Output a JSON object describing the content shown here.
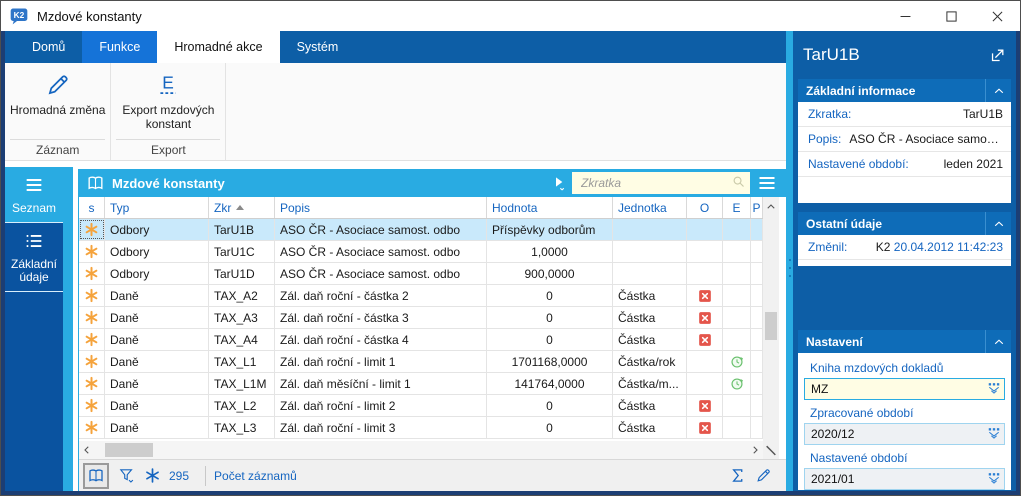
{
  "window": {
    "title": "Mzdové konstanty",
    "controls": [
      {
        "name": "minimize",
        "icon": "minimize-icon"
      },
      {
        "name": "maximize",
        "icon": "maximize-icon"
      },
      {
        "name": "close",
        "icon": "close-icon"
      }
    ]
  },
  "ribbon": {
    "tabs": [
      {
        "label": "Domů",
        "state": "normal"
      },
      {
        "label": "Funkce",
        "state": "highlight"
      },
      {
        "label": "Hromadné akce",
        "state": "active"
      },
      {
        "label": "Systém",
        "state": "normal"
      }
    ],
    "groups": [
      {
        "label": "Záznam",
        "buttons": [
          {
            "label": "Hromadná změna",
            "icon": "pencil-icon"
          }
        ]
      },
      {
        "label": "Export",
        "buttons": [
          {
            "label": "Export mzdových konstant",
            "icon": "export-e-icon"
          }
        ]
      }
    ]
  },
  "sidebar": {
    "items": [
      {
        "label": "Seznam",
        "icon": "menu-icon",
        "active": true
      },
      {
        "label": "Základní údaje",
        "icon": "list-icon",
        "active": false
      }
    ]
  },
  "browse": {
    "title": "Mzdové konstanty",
    "title_icon": "book-icon",
    "quick_filter_icon": "play-icon",
    "menu_icon": "hamburger-icon",
    "search_placeholder": "Zkratka",
    "search_icon": "search-icon",
    "columns": [
      {
        "key": "s",
        "label": "s"
      },
      {
        "key": "typ",
        "label": "Typ"
      },
      {
        "key": "zkr",
        "label": "Zkr",
        "sorted": "asc"
      },
      {
        "key": "popis",
        "label": "Popis"
      },
      {
        "key": "hodnota",
        "label": "Hodnota"
      },
      {
        "key": "jednotka",
        "label": "Jednotka"
      },
      {
        "key": "o",
        "label": "O"
      },
      {
        "key": "e",
        "label": "E"
      },
      {
        "key": "p",
        "label": "P"
      }
    ],
    "rows": [
      {
        "s": "asterisk-icon",
        "typ": "Odbory",
        "zkr": "TarU1B",
        "popis": "ASO ČR - Asociace samost. odbo",
        "hodnota": "Příspěvky odborům",
        "jednotka": "",
        "o": "",
        "e": "",
        "selected": true
      },
      {
        "s": "asterisk-icon",
        "typ": "Odbory",
        "zkr": "TarU1C",
        "popis": "ASO ČR - Asociace samost. odbo",
        "hodnota": "1,0000",
        "jednotka": "",
        "o": "",
        "e": ""
      },
      {
        "s": "asterisk-icon",
        "typ": "Odbory",
        "zkr": "TarU1D",
        "popis": "ASO ČR - Asociace samost. odbo",
        "hodnota": "900,0000",
        "jednotka": "",
        "o": "",
        "e": ""
      },
      {
        "s": "asterisk-icon",
        "typ": "Daně",
        "zkr": "TAX_A2",
        "popis": "Zál. daň roční - částka 2",
        "hodnota": "0",
        "jednotka": "Částka",
        "o": "red-x-icon",
        "e": ""
      },
      {
        "s": "asterisk-icon",
        "typ": "Daně",
        "zkr": "TAX_A3",
        "popis": "Zál. daň roční - částka 3",
        "hodnota": "0",
        "jednotka": "Částka",
        "o": "red-x-icon",
        "e": ""
      },
      {
        "s": "asterisk-icon",
        "typ": "Daně",
        "zkr": "TAX_A4",
        "popis": "Zál. daň roční - částka 4",
        "hodnota": "0",
        "jednotka": "Částka",
        "o": "red-x-icon",
        "e": ""
      },
      {
        "s": "asterisk-icon",
        "typ": "Daně",
        "zkr": "TAX_L1",
        "popis": "Zál. daň roční - limit 1",
        "hodnota": "1701168,0000",
        "jednotka": "Částka/rok",
        "o": "",
        "e": "green-refresh-icon"
      },
      {
        "s": "asterisk-icon",
        "typ": "Daně",
        "zkr": "TAX_L1M",
        "popis": "Zál. daň měsíční - limit 1",
        "hodnota": "141764,0000",
        "jednotka": "Částka/m...",
        "o": "",
        "e": "green-refresh-icon"
      },
      {
        "s": "asterisk-icon",
        "typ": "Daně",
        "zkr": "TAX_L2",
        "popis": "Zál. daň roční - limit 2",
        "hodnota": "0",
        "jednotka": "Částka",
        "o": "red-x-icon",
        "e": ""
      },
      {
        "s": "asterisk-icon",
        "typ": "Daně",
        "zkr": "TAX_L3",
        "popis": "Zál. daň roční - limit 3",
        "hodnota": "0",
        "jednotka": "Částka",
        "o": "red-x-icon",
        "e": ""
      }
    ],
    "status": {
      "book_icon": "book-icon",
      "filter_icon": "funnel-icon",
      "records_icon": "snowflake-icon",
      "count": "295",
      "count_label": "Počet záznamů",
      "sum_icon": "sigma-icon",
      "edit_icon": "pencil-icon"
    }
  },
  "panel": {
    "title": "TarU1B",
    "open_icon": "open-external-icon",
    "sections": [
      {
        "title": "Základní informace",
        "collapse_icon": "chevron-up-icon",
        "rows": [
          {
            "label": "Zkratka:",
            "value": "TarU1B"
          },
          {
            "label": "Popis:",
            "value": "ASO ČR - Asociace samost. o...",
            "inline": true
          },
          {
            "label": "Nastavené období:",
            "value": "leden 2021"
          }
        ]
      },
      {
        "title": "Ostatní údaje",
        "collapse_icon": "chevron-up-icon",
        "rows": [
          {
            "label": "Změnil:",
            "value_black": "K2",
            "value_blue": "20.04.2012 11:42:23"
          }
        ]
      },
      {
        "title": "Nastavení",
        "collapse_icon": "chevron-up-icon",
        "fields": [
          {
            "label": "Kniha mzdových dokladů",
            "value": "MZ",
            "highlight": true,
            "dropdown_icon": "dropdown-icon"
          },
          {
            "label": "Zpracované období",
            "value": "2020/12",
            "highlight": false,
            "dropdown_icon": "dropdown-icon"
          },
          {
            "label": "Nastavené období",
            "value": "2021/01",
            "highlight": false,
            "dropdown_icon": "dropdown-icon"
          }
        ]
      }
    ]
  },
  "colors": {
    "dark_blue": "#0d5ea6",
    "cyan_accent": "#29abe2",
    "selection_row": "#c9e9fb",
    "label_blue": "#1565c0",
    "input_yellow": "#fffde4",
    "asterisk_orange": "#f5a33c",
    "error_red": "#e4554b",
    "ok_green": "#69c06d"
  }
}
